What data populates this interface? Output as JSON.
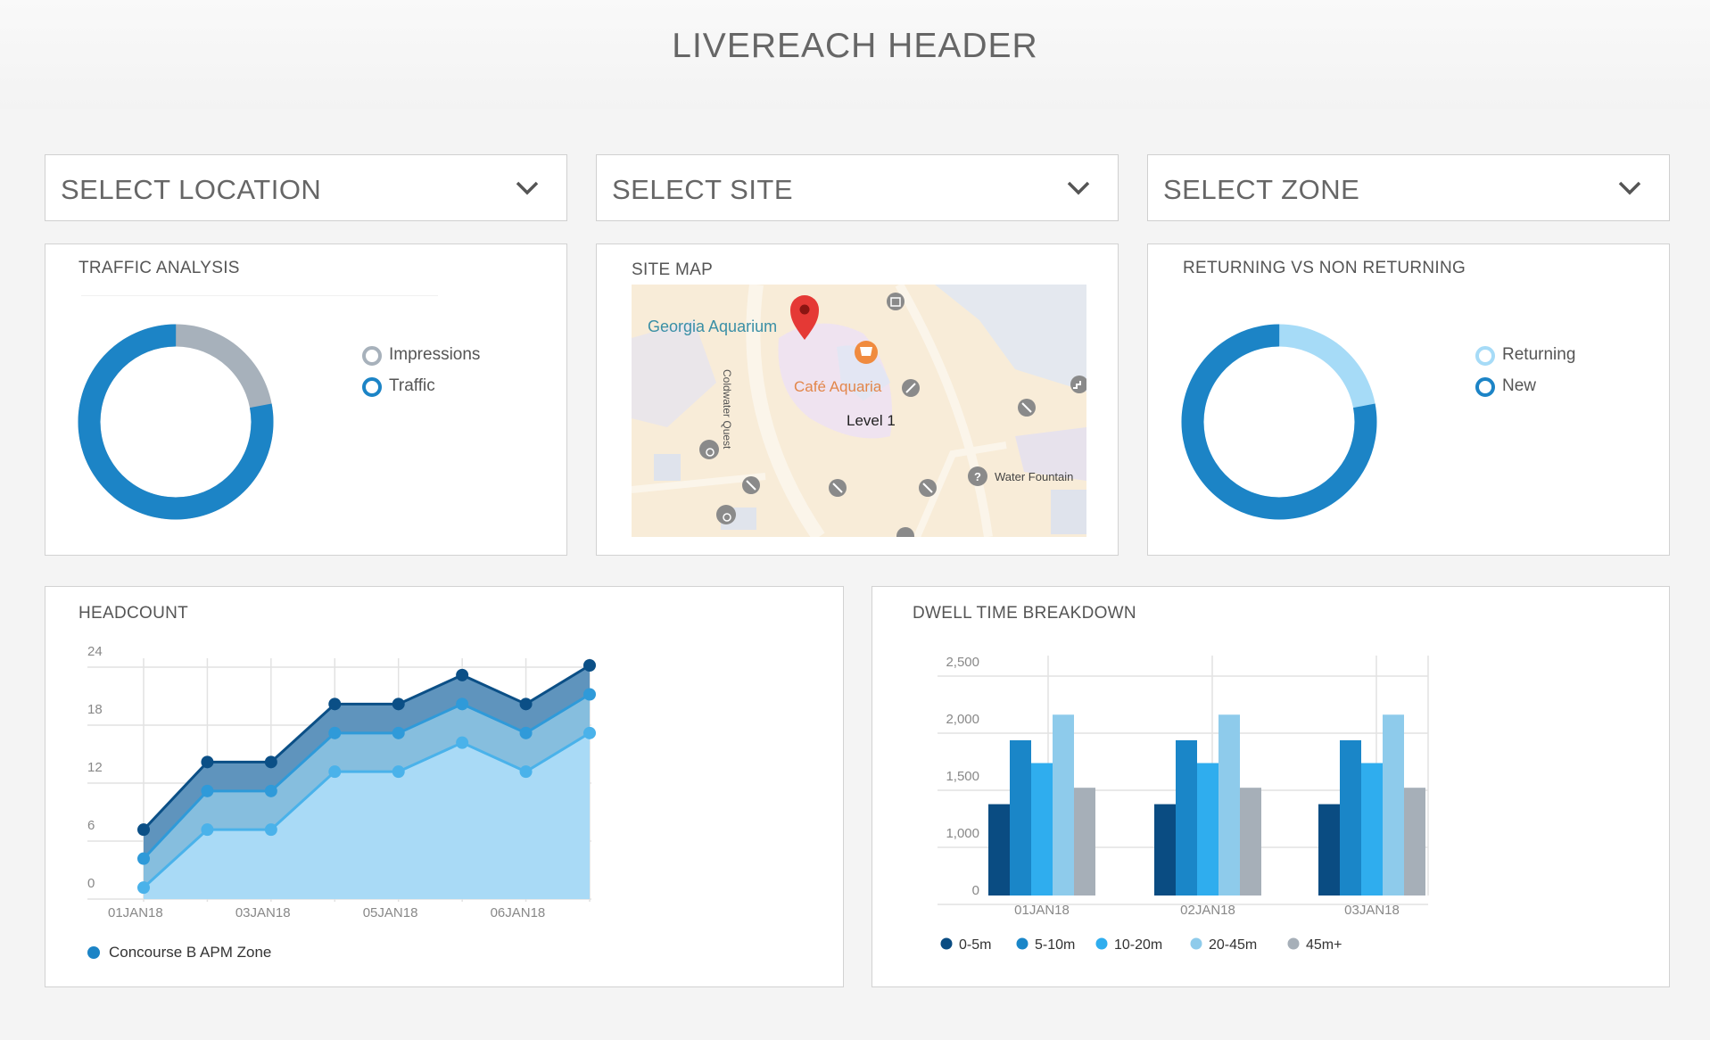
{
  "header": {
    "title": "LIVEREACH HEADER"
  },
  "selects": {
    "location": "SELECT LOCATION",
    "site": "SELECT SITE",
    "zone": "SELECT ZONE"
  },
  "traffic": {
    "title": "TRAFFIC ANALYSIS",
    "legend": [
      {
        "label": "Impressions",
        "color": "#a7b1bb"
      },
      {
        "label": "Traffic",
        "color": "#1c84c6"
      }
    ],
    "donut": {
      "traffic_fraction": 0.78
    }
  },
  "site_map": {
    "title": "SITE MAP",
    "labels": {
      "aquarium": "Georgia Aquarium",
      "cafe": "Café Aquaria",
      "level": "Level 1",
      "street": "Coldwater Quest",
      "fountain": "Water Fountain"
    }
  },
  "returning": {
    "title": "RETURNING VS NON RETURNING",
    "legend": [
      {
        "label": "Returning",
        "color": "#a6dbf7"
      },
      {
        "label": "New",
        "color": "#1c84c6"
      }
    ],
    "donut": {
      "new_fraction": 0.78
    }
  },
  "headcount": {
    "title": "HEADCOUNT",
    "legend_label": "Concourse B APM Zone",
    "legend_color": "#1c84c6"
  },
  "dwell": {
    "title": "DWELL TIME BREAKDOWN"
  },
  "chart_data": [
    {
      "type": "area",
      "y_ticks": [
        "24",
        "18",
        "12",
        "6",
        "0"
      ],
      "x_tick_labels": [
        "01JAN18",
        "03JAN18",
        "05JAN18",
        "06JAN18"
      ],
      "ylim": [
        0,
        24
      ],
      "series": [
        {
          "values": [
            7,
            14,
            14,
            20,
            20,
            23,
            20,
            24
          ],
          "color": "#0b4f86"
        },
        {
          "values": [
            4,
            11,
            11,
            17,
            17,
            20,
            17,
            21
          ],
          "color": "#2f9ad9"
        },
        {
          "values": [
            1,
            7,
            7,
            13,
            13,
            16,
            13,
            17
          ],
          "color": "#4ab2ea"
        }
      ]
    },
    {
      "type": "bar",
      "categories": [
        "01JAN18",
        "02JAN18",
        "03JAN18"
      ],
      "y_ticks": [
        "2,500",
        "2,000",
        "1,500",
        "1,000",
        "0"
      ],
      "ylim": [
        0,
        2500
      ],
      "series": [
        {
          "name": "0-5m",
          "color": "#0a4c82",
          "values": [
            1000,
            1000,
            1000
          ]
        },
        {
          "name": "5-10m",
          "color": "#1a86c8",
          "values": [
            1700,
            1700,
            1700
          ]
        },
        {
          "name": "10-20m",
          "color": "#2fadee",
          "values": [
            1450,
            1450,
            1450
          ]
        },
        {
          "name": "20-45m",
          "color": "#8ecbeb",
          "values": [
            1980,
            1980,
            1980
          ]
        },
        {
          "name": "45m+",
          "color": "#a6afb8",
          "values": [
            1180,
            1180,
            1180
          ]
        }
      ]
    }
  ]
}
